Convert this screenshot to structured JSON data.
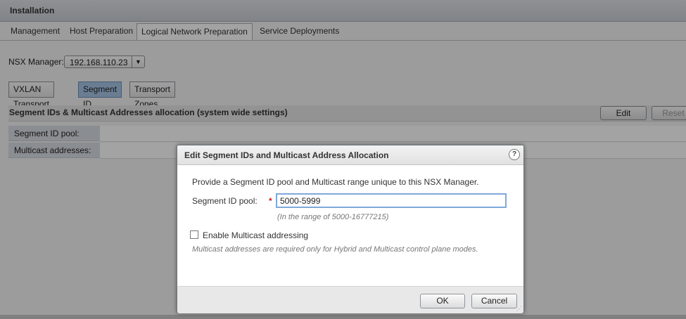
{
  "window": {
    "title": "Installation"
  },
  "tabs": [
    {
      "label": "Management"
    },
    {
      "label": "Host Preparation"
    },
    {
      "label": "Logical Network Preparation",
      "active": true
    },
    {
      "label": "Service Deployments"
    }
  ],
  "nsx_manager": {
    "label": "NSX Manager:",
    "value": "192.168.110.23"
  },
  "subtabs": [
    {
      "label": "VXLAN Transport"
    },
    {
      "label": "Segment ID",
      "active": true
    },
    {
      "label": "Transport Zones"
    }
  ],
  "section": {
    "title": "Segment IDs & Multicast Addresses allocation (system wide settings)",
    "edit_label": "Edit",
    "reset_label": "Reset"
  },
  "rows": [
    {
      "label": "Segment ID pool:"
    },
    {
      "label": "Multicast addresses:"
    }
  ],
  "dialog": {
    "title": "Edit Segment IDs and Multicast Address Allocation",
    "help_icon": "?",
    "intro": "Provide a Segment ID pool and Multicast range unique to this NSX Manager.",
    "segment_label": "Segment ID pool:",
    "required_mark": "*",
    "segment_value": "5000-5999",
    "segment_hint": "(In the range of 5000-16777215)",
    "multicast_checkbox_label": "Enable Multicast addressing",
    "multicast_checked": false,
    "multicast_note": "Multicast addresses are required only for Hybrid and Multicast control plane modes.",
    "ok_label": "OK",
    "cancel_label": "Cancel"
  },
  "colors": {
    "active_subtab": "#a7c4e6",
    "input_focus_border": "#7fa9d9",
    "required": "#d02020"
  }
}
